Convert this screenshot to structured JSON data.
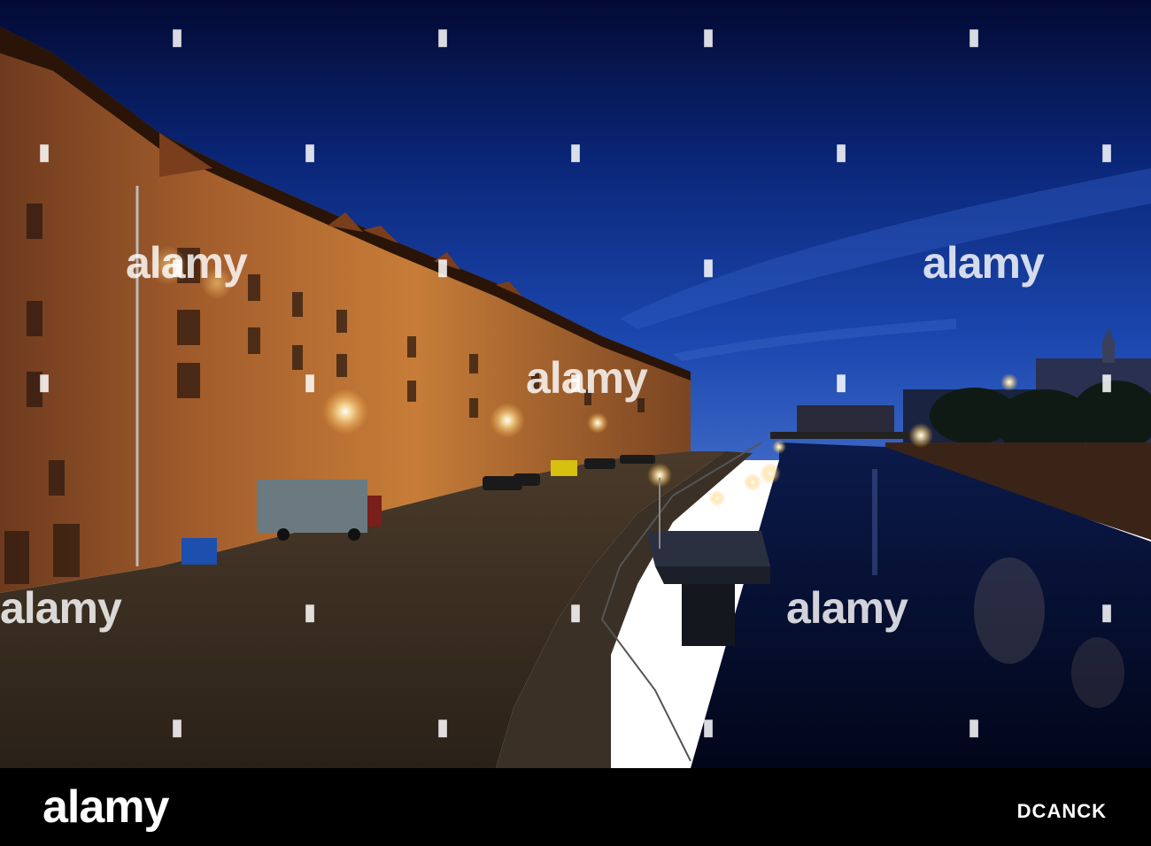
{
  "watermark": {
    "text": "alamy",
    "pin_glyph": "⬤",
    "color": "#ffffff"
  },
  "footer": {
    "logo": "alamy",
    "image_id": "DCANCK",
    "background": "#000000"
  },
  "palette": {
    "sky_top": "#040d3c",
    "sky_mid": "#0d2f8e",
    "sky_horizon": "#2a5cc7",
    "brick": "#8a4a24",
    "brick_lit": "#d08a3a",
    "water": "#050c2a",
    "cobble": "#5a4a36"
  }
}
